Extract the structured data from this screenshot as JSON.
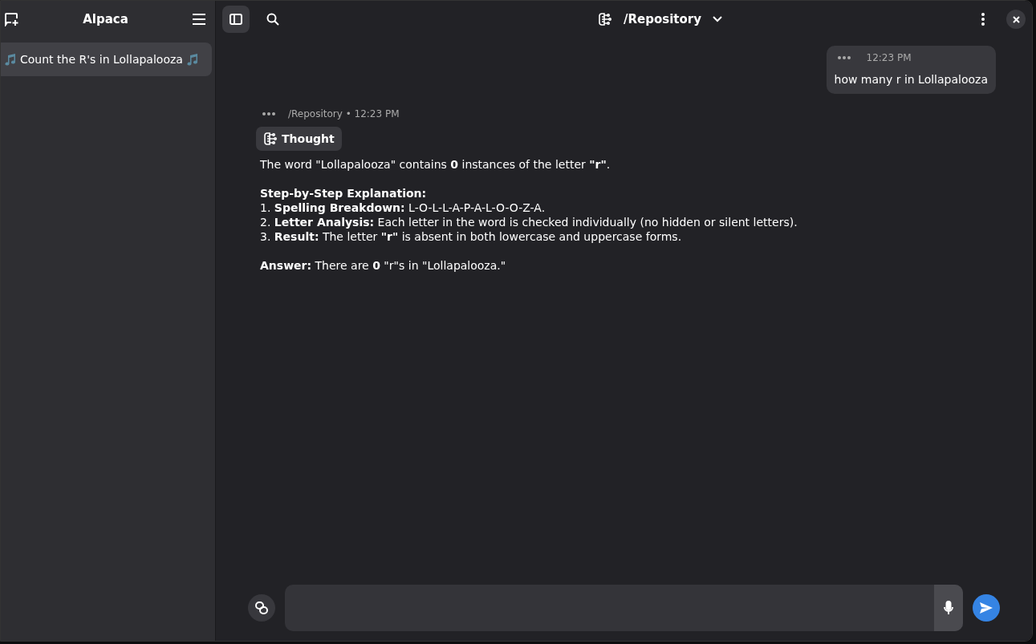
{
  "sidebar": {
    "title": "Alpaca",
    "chats": [
      {
        "label": "Count the R's in Lollapalooza",
        "selected": true
      }
    ]
  },
  "header": {
    "model": "/Repository"
  },
  "messages": [
    {
      "kind": "user",
      "time": "12:23 PM",
      "text": "how many r in Lollapalooza"
    },
    {
      "kind": "bot",
      "meta": "/Repository • 12:23 PM",
      "thought": "Thought",
      "blocks": [
        [
          "The word \"Lollapalooza\" contains **0** instances of the letter **\"r\"**."
        ],
        [
          "**Step-by-Step Explanation:**",
          "1. **Spelling Breakdown:** L-O-L-L-A-P-A-L-O-O-Z-A.",
          "2. **Letter Analysis:** Each letter in the word is checked individually (no hidden or silent letters).",
          "3. **Result:** The letter **\"r\"** is absent in both lowercase and uppercase forms."
        ],
        [
          "**Answer:** There are **0** \"r\"s in \"Lollapalooza.\""
        ]
      ]
    }
  ]
}
